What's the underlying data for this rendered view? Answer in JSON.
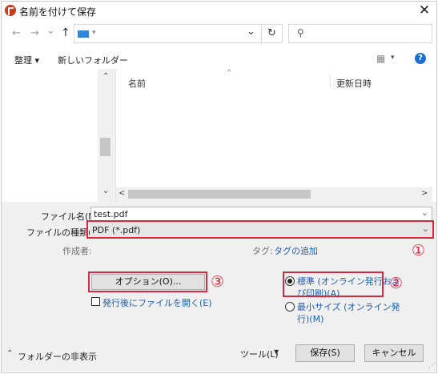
{
  "window": {
    "title": "名前を付けて保存",
    "close_glyph": "✕"
  },
  "nav": {
    "back": "←",
    "forward": "→",
    "dropdown": "⌄",
    "up": "↑",
    "addr_caret": "▾",
    "chevron": "⌄",
    "refresh": "↻",
    "search_glyph": "⚲"
  },
  "toolbar": {
    "organize": "整理 ▾",
    "new_folder": "新しいフォルダー",
    "view_glyph": "▦",
    "view_caret": "▾",
    "help": "?"
  },
  "file_list": {
    "sort_glyph": "⌃",
    "columns": [
      "名前",
      "更新日時"
    ],
    "scroll_up": "⌃",
    "scroll_down": "⌄",
    "scroll_left": "<",
    "scroll_right": ">"
  },
  "form": {
    "filename_label": "ファイル名(N):",
    "filename_value": "test.pdf",
    "filetype_label": "ファイルの種類(T):",
    "filetype_value": "PDF (*.pdf)",
    "dropdown_glyph": "⌄",
    "author_label": "作成者:",
    "tag_label": "タグ:",
    "tag_link": "タグの追加"
  },
  "options": {
    "options_button": "オプション(O)...",
    "open_after_label": "発行後にファイルを開く(E)",
    "radio_standard_line1": "標準 (オンライン発行およ",
    "radio_standard_line2": "び印刷)(A)",
    "radio_min_line1": "最小サイズ (オンライン発",
    "radio_min_line2": "行)(M)"
  },
  "annotations": {
    "one": "①",
    "two": "②",
    "three": "③"
  },
  "footer": {
    "hide_folders": "フォルダーの非表示",
    "hide_caret": "⌃",
    "tools": "ツール(L)",
    "tools_caret": "▼",
    "save": "保存(S)",
    "cancel": "キャンセル",
    "grip": "⋰"
  },
  "colors": {
    "accent": "#1a5fb4",
    "highlight_red": "#d9283b",
    "folder_blue": "#2f87d8",
    "dialog_bg": "#f0f0f0"
  }
}
